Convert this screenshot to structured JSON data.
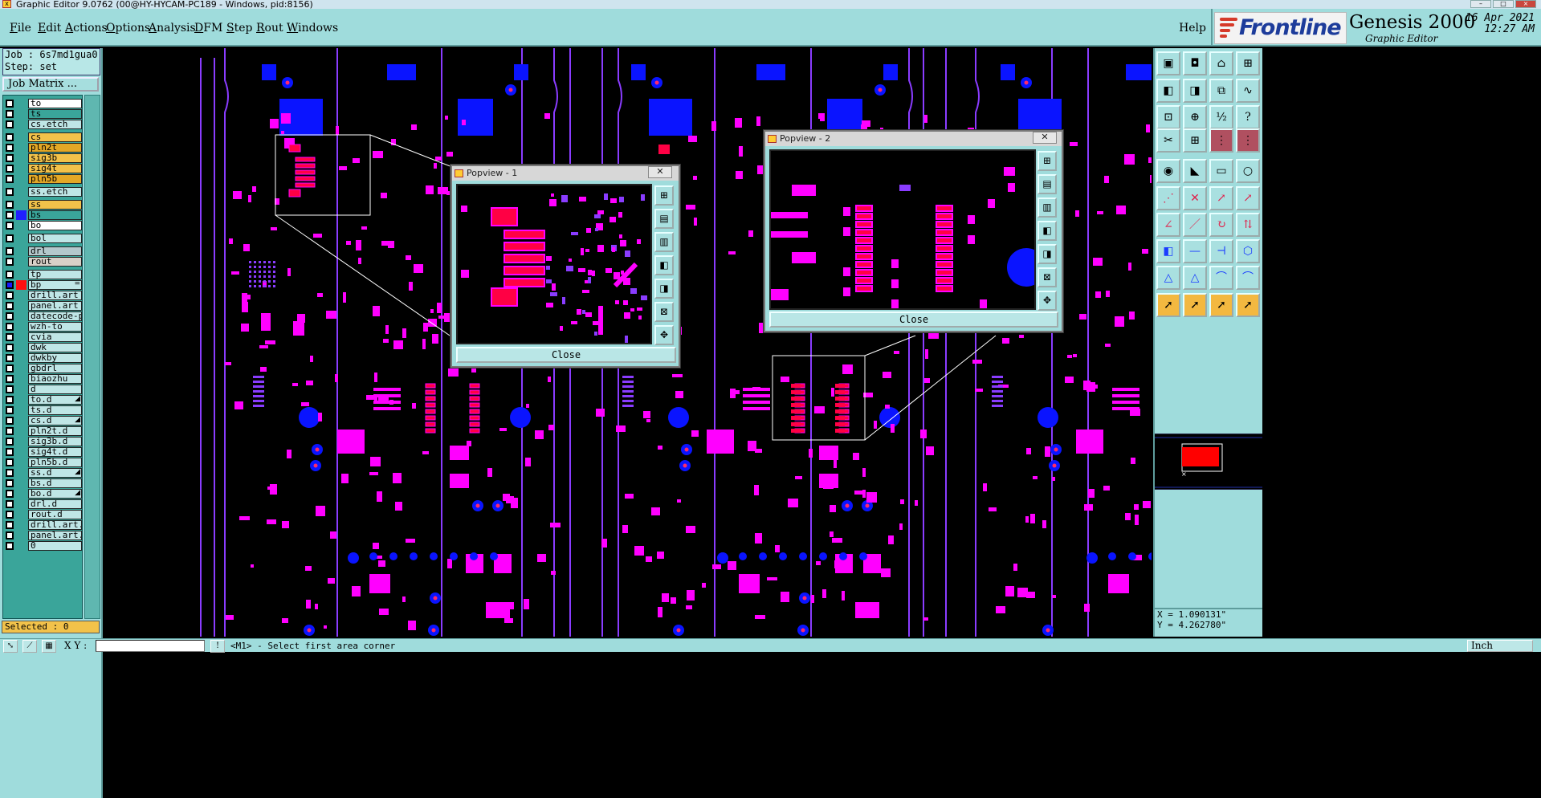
{
  "window": {
    "title": "Graphic Editor 9.0762 (00@HY-HYCAM-PC189 - Windows, pid:8156)"
  },
  "menubar": {
    "items": [
      "File",
      "Edit",
      "Actions",
      "Options",
      "Analysis",
      "DFM",
      "Step",
      "Rout",
      "Windows"
    ],
    "help": "Help"
  },
  "brand": {
    "logo": "Frontline",
    "product": "Genesis 2000",
    "subtitle": "Graphic Editor",
    "date": "16 Apr 2021",
    "time": "12:27 AM"
  },
  "job": {
    "job_line": "Job : 6s7md1gua0",
    "step_line": "Step: set",
    "matrix_button": "Job Matrix ..."
  },
  "layers": [
    {
      "name": "to",
      "bg": "#ffffff",
      "swatch": ""
    },
    {
      "name": "ts",
      "bg": "#3aa59a",
      "swatch": ""
    },
    {
      "name": "cs.etch",
      "bg": "#bfe6e6",
      "swatch": ""
    },
    {
      "name": "cs",
      "bg": "#f2c24a",
      "swatch": ""
    },
    {
      "name": "pln2t",
      "bg": "#e3a826",
      "swatch": ""
    },
    {
      "name": "sig3b",
      "bg": "#f2c24a",
      "swatch": ""
    },
    {
      "name": "sig4t",
      "bg": "#f2c24a",
      "swatch": ""
    },
    {
      "name": "pln5b",
      "bg": "#e3a826",
      "swatch": ""
    },
    {
      "name": "ss.etch",
      "bg": "#bfe6e6",
      "swatch": ""
    },
    {
      "name": "ss",
      "bg": "#f2c24a",
      "swatch": ""
    },
    {
      "name": "bs",
      "bg": "#3aa59a",
      "swatch": "#2020ff"
    },
    {
      "name": "bo",
      "bg": "#ffffff",
      "swatch": ""
    },
    {
      "name": "bol",
      "bg": "#bfe6e6",
      "swatch": ""
    },
    {
      "name": "drl",
      "bg": "#b4c8cc",
      "swatch": ""
    },
    {
      "name": "rout",
      "bg": "#d8d0c8",
      "swatch": ""
    },
    {
      "name": "tp",
      "bg": "#bfe6e6",
      "swatch": ""
    },
    {
      "name": "bp",
      "bg": "#bfe6e6",
      "swatch": "#ff1010",
      "checked": true,
      "flag": "="
    },
    {
      "name": "drill.art",
      "bg": "#bfe6e6",
      "swatch": ""
    },
    {
      "name": "panel.art",
      "bg": "#bfe6e6",
      "swatch": ""
    },
    {
      "name": "datecode-pt",
      "bg": "#bfe6e6",
      "swatch": ""
    },
    {
      "name": "wzh-to",
      "bg": "#bfe6e6",
      "swatch": ""
    },
    {
      "name": "cvia",
      "bg": "#bfe6e6",
      "swatch": ""
    },
    {
      "name": "dwk",
      "bg": "#bfe6e6",
      "swatch": ""
    },
    {
      "name": "dwkby",
      "bg": "#bfe6e6",
      "swatch": ""
    },
    {
      "name": "gbdrl",
      "bg": "#bfe6e6",
      "swatch": ""
    },
    {
      "name": "biaozhu",
      "bg": "#bfe6e6",
      "swatch": ""
    },
    {
      "name": "d",
      "bg": "#bfe6e6",
      "swatch": ""
    },
    {
      "name": "to.d",
      "bg": "#bfe6e6",
      "swatch": "",
      "flag": "◢"
    },
    {
      "name": "ts.d",
      "bg": "#bfe6e6",
      "swatch": ""
    },
    {
      "name": "cs.d",
      "bg": "#bfe6e6",
      "swatch": "",
      "flag": "◢"
    },
    {
      "name": "pln2t.d",
      "bg": "#bfe6e6",
      "swatch": ""
    },
    {
      "name": "sig3b.d",
      "bg": "#bfe6e6",
      "swatch": ""
    },
    {
      "name": "sig4t.d",
      "bg": "#bfe6e6",
      "swatch": ""
    },
    {
      "name": "pln5b.d",
      "bg": "#bfe6e6",
      "swatch": ""
    },
    {
      "name": "ss.d",
      "bg": "#bfe6e6",
      "swatch": "",
      "flag": "◢"
    },
    {
      "name": "bs.d",
      "bg": "#bfe6e6",
      "swatch": ""
    },
    {
      "name": "bo.d",
      "bg": "#bfe6e6",
      "swatch": "",
      "flag": "◢"
    },
    {
      "name": "drl.d",
      "bg": "#bfe6e6",
      "swatch": ""
    },
    {
      "name": "rout.d",
      "bg": "#bfe6e6",
      "swatch": ""
    },
    {
      "name": "drill.art.d",
      "bg": "#bfe6e6",
      "swatch": ""
    },
    {
      "name": "panel.art.d",
      "bg": "#bfe6e6",
      "swatch": ""
    },
    {
      "name": "0",
      "bg": "#bfe6e6",
      "swatch": ""
    }
  ],
  "selected": "Selected : 0",
  "popview1": {
    "title": "Popview - 1",
    "close": "Close"
  },
  "popview2": {
    "title": "Popview - 2",
    "close": "Close"
  },
  "coordinates": {
    "x": "X = 1.090131\"",
    "y": "Y = 4.262780\""
  },
  "status": {
    "xy_label": "X Y :",
    "xy_value": "",
    "prompt": "<M1> - Select first area corner",
    "units": "Inch"
  },
  "colors": {
    "panel": "#9fdcdc",
    "pad_magenta": "#ff00ff",
    "pad_blue": "#0a14ff",
    "pad_red": "#ff0044",
    "trace_purple": "#8a3cff"
  },
  "icons": [
    "close-icon",
    "window-icon",
    "zoom-in-icon",
    "zoom-out-icon",
    "pan-icon",
    "select-icon",
    "measure-icon",
    "snap-icon",
    "pointer-icon"
  ]
}
